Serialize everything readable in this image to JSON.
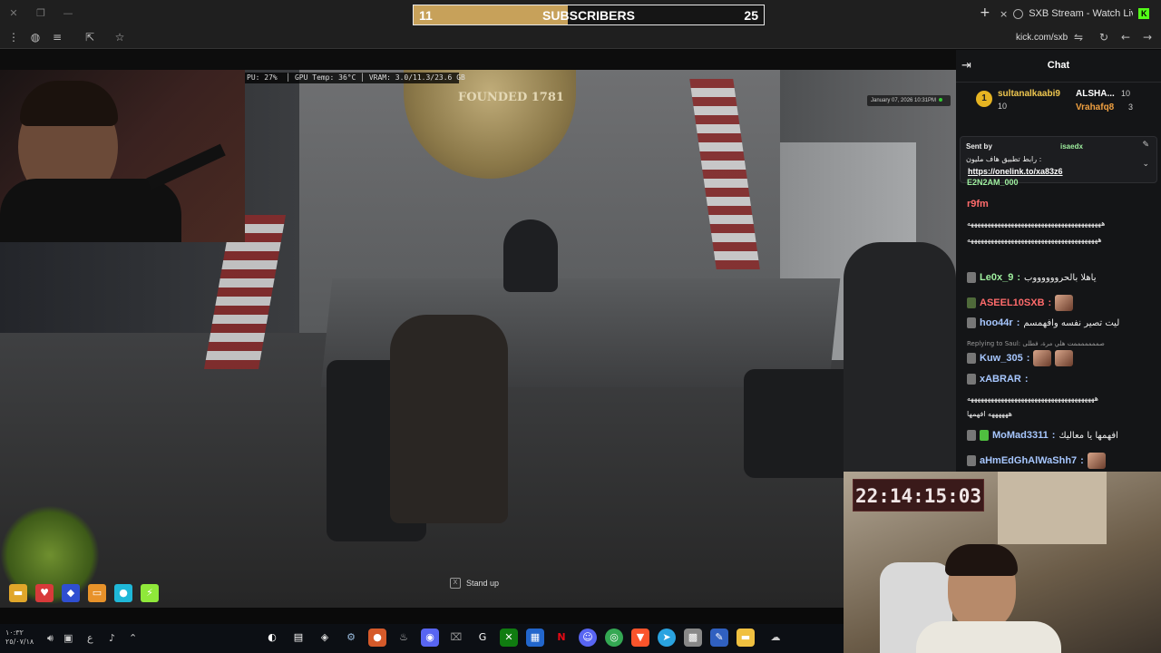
{
  "subscriber_goal": {
    "current": "11",
    "label": "SUBSCRIBERS",
    "target": "25",
    "progress_fraction": 0.44,
    "colors": {
      "fill": "#c7a15a",
      "border": "#e8e8e8"
    }
  },
  "browser": {
    "tab_title": "SXB Stream - Watch Live on",
    "tab_close": "×",
    "new_tab": "+",
    "url": "kick.com/sxb"
  },
  "game_overlay": {
    "gpu_stats": "PU: 27%  │ GPU Temp: 36°C │ VRAM: 3.0/11.3/23.6 GB",
    "datetime": "January 07, 2026 10:31PM",
    "seal_text": "FOUNDED 1781",
    "prompt_key": "X",
    "prompt_label": "Stand up",
    "hud_icons": [
      "folder-icon",
      "heart-icon",
      "shield-icon",
      "briefcase-icon",
      "water-icon",
      "energy-icon"
    ]
  },
  "chat": {
    "title": "Chat",
    "leaderboard": [
      {
        "rank": "1",
        "name": "sultanalkaabi9",
        "count": "10"
      },
      {
        "name": "ALSHA...",
        "count": "10"
      },
      {
        "name": "Vrahafq8",
        "count": "3"
      }
    ],
    "pinned": {
      "sent_by_label": "Sent by",
      "sent_by_user": "isaedx",
      "message": "رابط تطبيق هاف مليون :",
      "link": "https://onelink.to/xa83z6"
    },
    "partial_username": "E2N2AM_000",
    "messages": [
      {
        "user": "r9fm",
        "color": "#ff6b6b",
        "text": "",
        "long": "ههههههههههههههههههههههههههههههههههههههههه"
      },
      {
        "long2": "هههههههههههههههههههههههههههههههههههههههه"
      },
      {
        "user": "Le0x_9",
        "color": "#9ff09f",
        "text": "ياهلا بالحرووووووب"
      },
      {
        "user": "ASEEL10SXB",
        "color": "#ff6b6b",
        "text": ""
      },
      {
        "user": "hoo44r",
        "color": "#a7c7ff",
        "text": "ليت تصير نفسه وافهمسم"
      },
      {
        "reply": "Replying to Saul: صمممممممت هلي مرة، فطلى"
      },
      {
        "user": "Kuw_305",
        "color": "#a7c7ff",
        "text": ""
      },
      {
        "user": "xABRAR",
        "color": "#a7c7ff",
        "text": "",
        "long": "ههههههههههههههههههههههههههههههههههههههه"
      },
      {
        "long2": "ههههههه افهمها"
      },
      {
        "user": "MoMad3311",
        "color": "#a7c7ff",
        "text": "افهمها يا معاليك"
      },
      {
        "user": "aHmEdGhAlWaShh7",
        "color": "#a7c7ff",
        "text": ""
      }
    ]
  },
  "timer": "22:14:15:03",
  "taskbar": {
    "time": "١٠:٣٢",
    "date": "٢٥/٠٧/١٨",
    "lang": "ع"
  }
}
